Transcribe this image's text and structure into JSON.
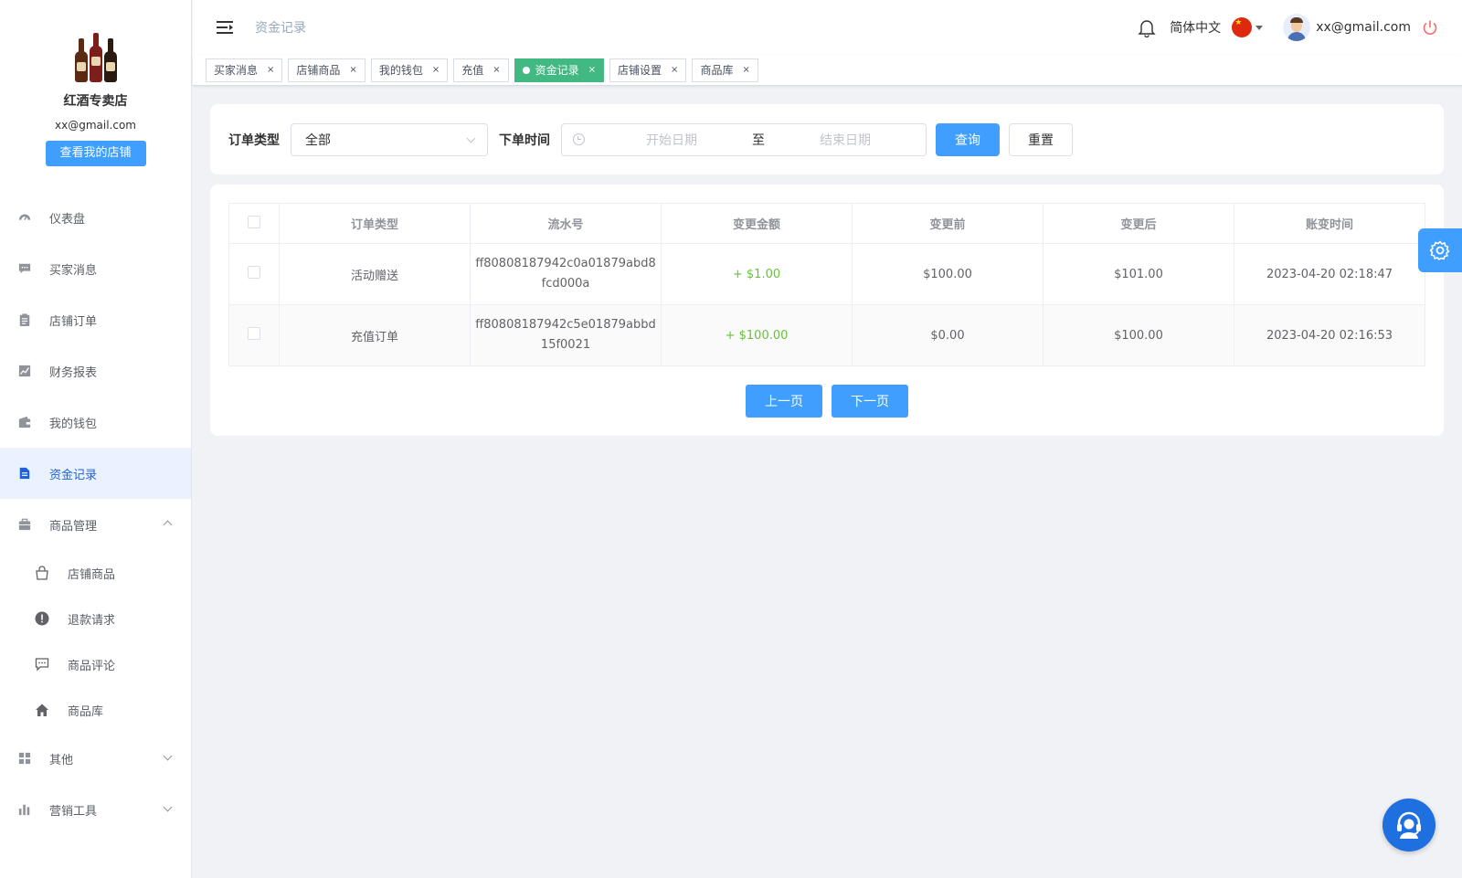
{
  "shop": {
    "name": "红酒专卖店",
    "email": "xx@gmail.com",
    "view_button": "查看我的店铺"
  },
  "menu": {
    "dashboard": "仪表盘",
    "buyer_messages": "买家消息",
    "store_orders": "店铺订单",
    "financial_reports": "财务报表",
    "my_wallet": "我的钱包",
    "fund_records": "资金记录",
    "product_management": "商品管理",
    "store_products": "店铺商品",
    "refund_requests": "退款请求",
    "product_reviews": "商品评论",
    "product_library": "商品库",
    "others": "其他",
    "marketing_tools": "营销工具"
  },
  "header": {
    "breadcrumb": "资金记录",
    "language": "简体中文",
    "user_email": "xx@gmail.com"
  },
  "tabs": [
    "买家消息",
    "店铺商品",
    "我的钱包",
    "充值",
    "资金记录",
    "店铺设置",
    "商品库"
  ],
  "active_tab": "资金记录",
  "filter": {
    "order_type_label": "订单类型",
    "order_type_value": "全部",
    "order_time_label": "下单时间",
    "start_placeholder": "开始日期",
    "range_separator": "至",
    "end_placeholder": "结束日期",
    "query_button": "查询",
    "reset_button": "重置"
  },
  "table": {
    "headers": [
      "订单类型",
      "流水号",
      "变更金额",
      "变更前",
      "变更后",
      "账变时间"
    ],
    "rows": [
      {
        "type": "活动赠送",
        "serial_line1": "ff80808187942c0a01879abd8",
        "serial_line2": "fcd000a",
        "amount": "+ $1.00",
        "before": "$100.00",
        "after": "$101.00",
        "time": "2023-04-20 02:18:47"
      },
      {
        "type": "充值订单",
        "serial_line1": "ff80808187942c5e01879abbd",
        "serial_line2": "15f0021",
        "amount": "+ $100.00",
        "before": "$0.00",
        "after": "$100.00",
        "time": "2023-04-20 02:16:53"
      }
    ]
  },
  "pagination": {
    "prev": "上一页",
    "next": "下一页"
  },
  "colors": {
    "primary": "#409eff",
    "active_tab": "#42b983",
    "positive_amount": "#67c23a",
    "menu_active_bg": "#eaf2ff"
  }
}
